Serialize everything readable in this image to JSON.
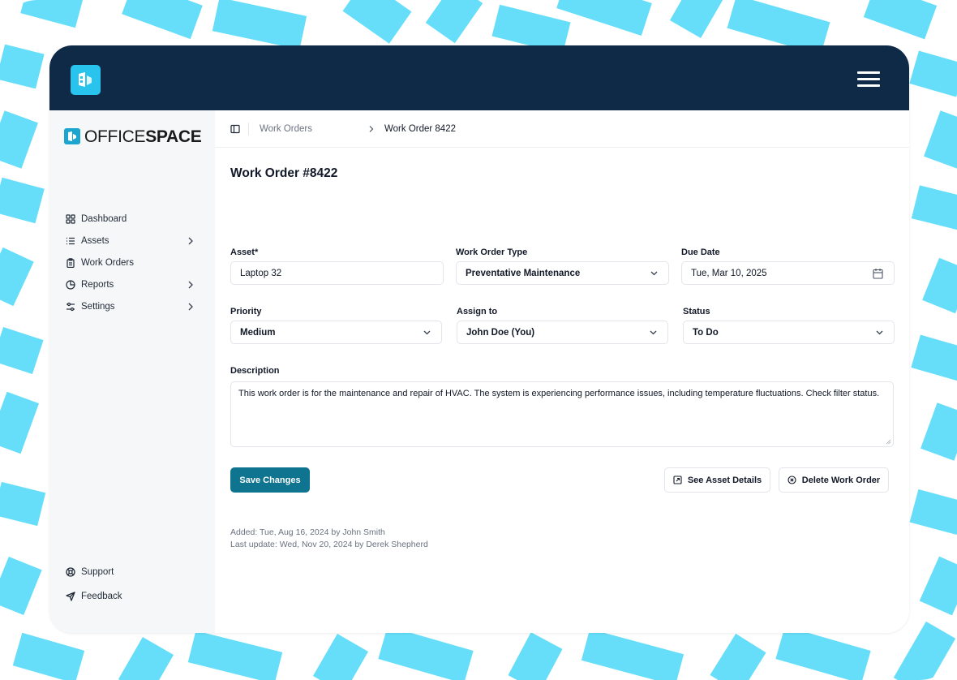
{
  "brand": {
    "name_light": "OFFICE",
    "name_bold": "SPACE"
  },
  "topbar": {
    "logo_icon": "officespace-logo-icon",
    "menu_icon": "hamburger-menu-icon"
  },
  "colors": {
    "accent": "#0e7490",
    "topbar": "#0e2a47",
    "brand_cyan": "#29c4ee",
    "stripes": "#66def9"
  },
  "sidebar": {
    "items": [
      {
        "label": "Dashboard",
        "icon": "dashboard-grid-icon",
        "has_children": false
      },
      {
        "label": "Assets",
        "icon": "list-icon",
        "has_children": true
      },
      {
        "label": "Work Orders",
        "icon": "clipboard-icon",
        "has_children": false
      },
      {
        "label": "Reports",
        "icon": "pie-chart-icon",
        "has_children": true
      },
      {
        "label": "Settings",
        "icon": "sliders-icon",
        "has_children": true
      }
    ],
    "footer": [
      {
        "label": "Support",
        "icon": "lifebuoy-icon"
      },
      {
        "label": "Feedback",
        "icon": "send-icon"
      }
    ]
  },
  "breadcrumb": {
    "parent": "Work Orders",
    "current": "Work Order 8422"
  },
  "page": {
    "title": "Work Order #8422"
  },
  "form": {
    "asset": {
      "label": "Asset*",
      "value": "Laptop 32"
    },
    "work_order_type": {
      "label": "Work Order Type",
      "value": "Preventative Maintenance"
    },
    "due_date": {
      "label": "Due Date",
      "value": "Tue, Mar 10, 2025"
    },
    "priority": {
      "label": "Priority",
      "value": "Medium"
    },
    "assign_to": {
      "label": "Assign to",
      "value": "John Doe (You)"
    },
    "status": {
      "label": "Status",
      "value": "To Do"
    },
    "description": {
      "label": "Description",
      "value": "This work order is for the maintenance and repair of HVAC. The system is experiencing performance issues, including temperature fluctuations. Check filter status."
    }
  },
  "actions": {
    "save": "Save Changes",
    "see_asset": "See Asset Details",
    "delete": "Delete Work Order"
  },
  "meta": {
    "added": "Added: Tue, Aug 16, 2024 by John Smith",
    "updated": "Last update: Wed, Nov 20, 2024 by Derek Shepherd"
  }
}
